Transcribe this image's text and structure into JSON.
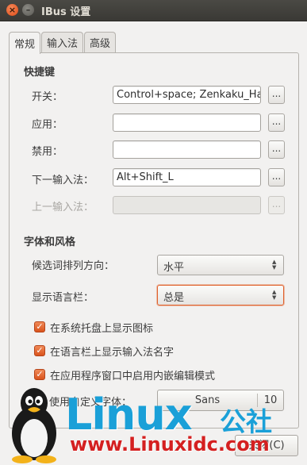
{
  "window": {
    "title": "IBus 设置"
  },
  "tabs": [
    {
      "label": "常规",
      "active": true
    },
    {
      "label": "输入法",
      "active": false
    },
    {
      "label": "高级",
      "active": false
    }
  ],
  "shortcuts": {
    "heading": "快捷键",
    "rows": [
      {
        "label": "开关：",
        "value": "Control+space; Zenkaku_Ha",
        "button": "...",
        "enabled": true
      },
      {
        "label": "应用：",
        "value": "",
        "button": "...",
        "enabled": true
      },
      {
        "label": "禁用：",
        "value": "",
        "button": "...",
        "enabled": true
      },
      {
        "label": "下一输入法：",
        "value": "Alt+Shift_L",
        "button": "...",
        "enabled": true
      },
      {
        "label": "上一输入法：",
        "value": "",
        "button": "...",
        "enabled": false
      }
    ]
  },
  "style": {
    "heading": "字体和风格",
    "orientation": {
      "label": "候选词排列方向：",
      "value": "水平"
    },
    "language_bar": {
      "label": "显示语言栏：",
      "value": "总是"
    },
    "checkboxes": [
      {
        "label": "在系统托盘上显示图标",
        "checked": true
      },
      {
        "label": "在语言栏上显示输入法名字",
        "checked": true
      },
      {
        "label": "在应用程序窗口中启用内嵌编辑模式",
        "checked": true
      }
    ],
    "custom_font": {
      "label": "使用自定义字体：",
      "font_name": "Sans",
      "font_size": "10"
    }
  },
  "footer": {
    "close_label": "关闭(C)"
  },
  "watermark": {
    "brand": "Linux",
    "brand_cn": "公社",
    "url": "www.Linuxidc.com"
  },
  "colors": {
    "accent": "#e0602b",
    "titlebar": "#3c3b37",
    "watermark_blue": "#1aa0d8",
    "watermark_red": "#d42020"
  }
}
